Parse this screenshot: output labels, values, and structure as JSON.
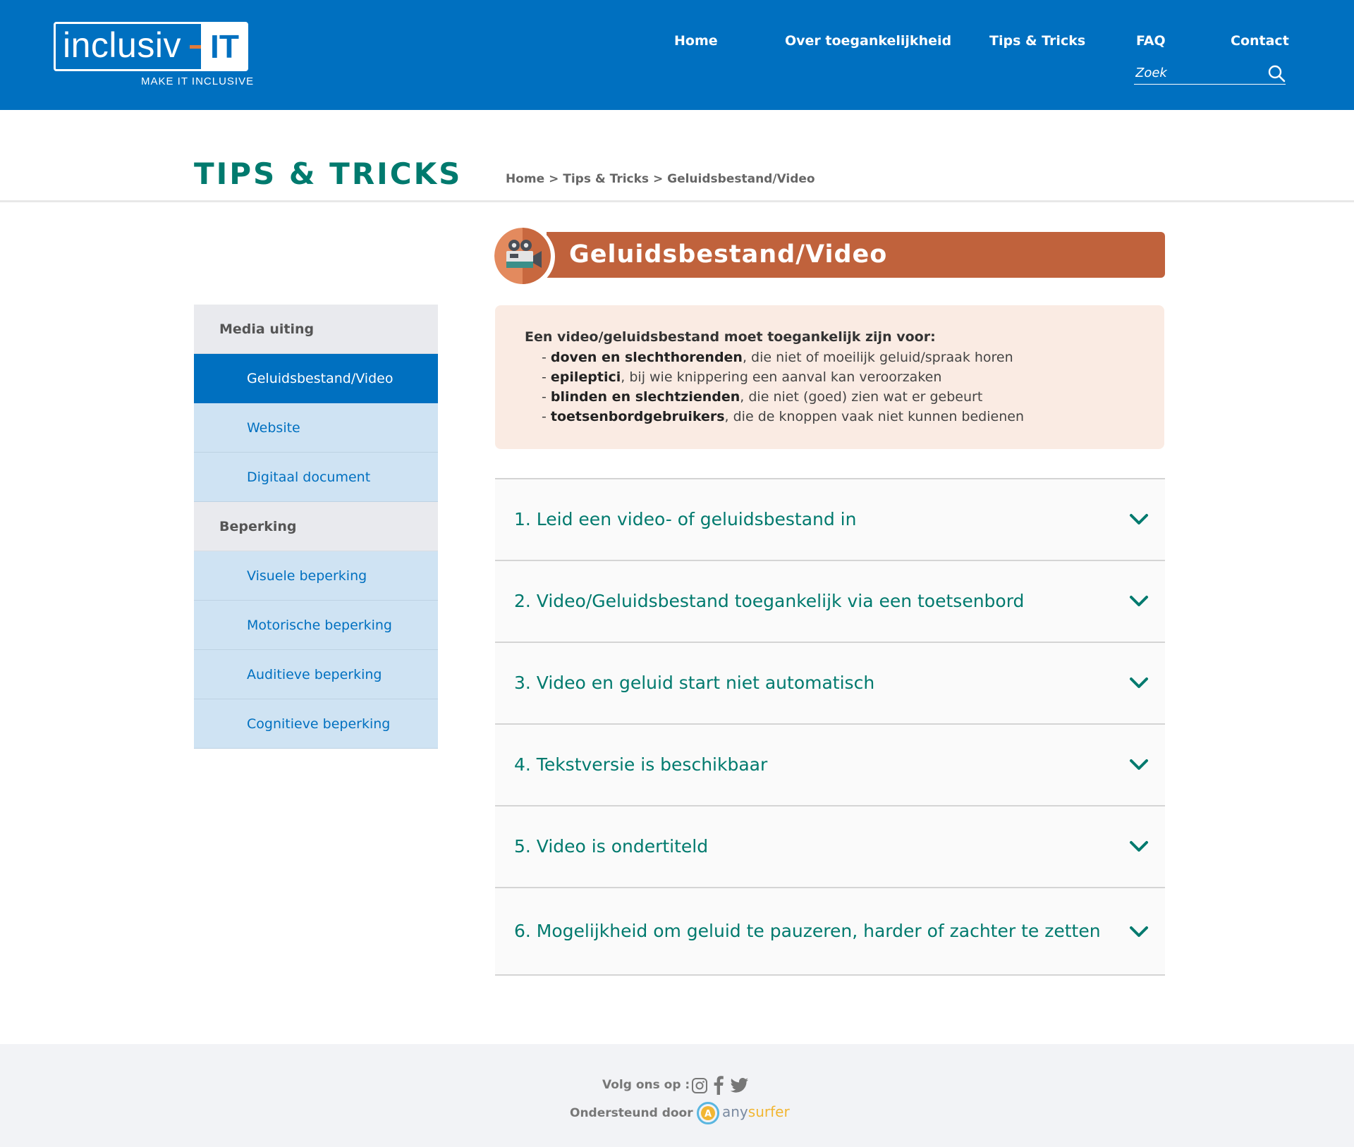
{
  "header": {
    "logo": {
      "word": "inclusiv",
      "it": "IT",
      "tagline": "MAKE IT INCLUSIVE"
    },
    "nav": [
      {
        "label": "Home"
      },
      {
        "label": "Over toegankelijkheid"
      },
      {
        "label": "Tips & Tricks"
      },
      {
        "label": "FAQ"
      },
      {
        "label": "Contact"
      }
    ],
    "search": {
      "placeholder": "Zoek",
      "value": "",
      "icon": "search-icon"
    }
  },
  "page": {
    "title": "TIPS & TRICKS",
    "breadcrumb": "Home > Tips & Tricks > Geluidsbestand/Video"
  },
  "sidebar": {
    "groups": [
      {
        "label": "Media uiting",
        "items": [
          {
            "label": "Geluidsbestand/Video",
            "active": true
          },
          {
            "label": "Website"
          },
          {
            "label": "Digitaal document"
          }
        ]
      },
      {
        "label": "Beperking",
        "items": [
          {
            "label": "Visuele beperking"
          },
          {
            "label": "Motorische beperking"
          },
          {
            "label": "Auditieve beperking"
          },
          {
            "label": "Cognitieve beperking"
          }
        ]
      }
    ]
  },
  "topic": {
    "title": "Geluidsbestand/Video",
    "icon": "video-camera-icon",
    "color": "#c0623c"
  },
  "infobox": {
    "heading": "Een video/geluidsbestand moet toegankelijk zijn voor:",
    "items": [
      {
        "bold": "doven en slechthorenden",
        "rest": ", die niet of moeilijk geluid/spraak horen"
      },
      {
        "bold": "epileptici",
        "rest": ", bij wie knippering een aanval kan veroorzaken"
      },
      {
        "bold": "blinden en slechtzienden",
        "rest": ", die niet (goed) zien wat er gebeurt"
      },
      {
        "bold": "toetsenbordgebruikers",
        "rest": ", die de knoppen vaak niet kunnen bedienen"
      }
    ]
  },
  "accordion": [
    {
      "title": "1. Leid een video- of geluidsbestand in"
    },
    {
      "title": "2. Video/Geluidsbestand toegankelijk via een toetsenbord"
    },
    {
      "title": "3. Video en geluid start niet automatisch"
    },
    {
      "title": "4. Tekstversie is beschikbaar"
    },
    {
      "title": "5. Video is ondertiteld"
    },
    {
      "title": "6. Mogelijkheid om geluid te pauzeren, harder of zachter te zetten"
    }
  ],
  "footer": {
    "follow_label": "Volg ons op :",
    "social": [
      "instagram-icon",
      "facebook-icon",
      "twitter-icon"
    ],
    "supported_label": "Ondersteund door",
    "sponsor": {
      "any": "any",
      "surfer": "surfer"
    }
  },
  "colors": {
    "brand_blue": "#0070c0",
    "teal": "#007a6e",
    "topic_orange": "#c0623c",
    "infobox_bg": "#faebe3",
    "sidebar_item_bg": "#cfe3f3",
    "sidebar_cat_bg": "#e9eaee",
    "footer_bg": "#f2f3f6"
  }
}
